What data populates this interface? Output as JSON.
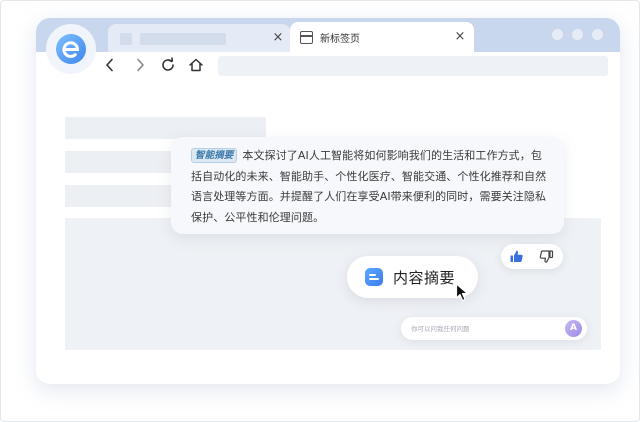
{
  "tabs": {
    "active_title": "新标签页",
    "close_glyph": "×"
  },
  "summary": {
    "tag": "智能摘要",
    "text": "本文探讨了AI人工智能将如何影响我们的生活和工作方式，包括自动化的未来、智能助手、个性化医疗、智能交通、个性化推荐和自然语言处理等方面。并提醒了人们在享受AI带来便利的同时，需要关注隐私保护、公平性和伦理问题。"
  },
  "action_button": {
    "label": "内容摘要"
  },
  "ask": {
    "placeholder": "你可以问我任何问题",
    "avatar_letter": "A"
  },
  "icons": {
    "logo": "browser-e-logo-icon",
    "back": "chevron-left-icon",
    "forward": "chevron-right-icon",
    "reload": "reload-icon",
    "home": "home-icon",
    "tab": "tab-page-icon",
    "like": "thumbs-up-icon",
    "dislike": "thumbs-down-icon",
    "cursor": "mouse-cursor-icon"
  },
  "colors": {
    "tabstrip": "#c9d7ee",
    "accent_blue": "#3d7bf0",
    "like_active": "#3a6fe0",
    "avatar_purple": "#9c8ae6"
  }
}
